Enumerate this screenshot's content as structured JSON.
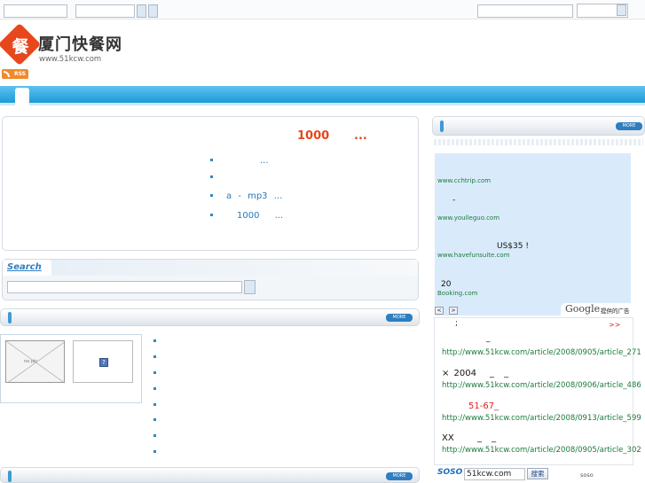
{
  "top": {
    "search_placeholder": ""
  },
  "logo": {
    "glyph": "餐",
    "name": "厦门快餐网",
    "url": "www.51kcw.com",
    "rss": "RSS"
  },
  "headline": {
    "count": "1000",
    "suffix": "...",
    "items": [
      "...",
      "",
      "a - mp3 ...",
      "1000 ..."
    ]
  },
  "search": {
    "title": "Search",
    "value": ""
  },
  "more_label": "MORE",
  "news_panel": {
    "broken_image_text": "no pic",
    "dot_count": 8
  },
  "ads": {
    "links": [
      "www.cchtrip.com",
      "-",
      "www.youlleguo.com",
      "US$35 !",
      "www.havefunsuite.com",
      "20",
      "Booking.com"
    ],
    "google": "Google",
    "google_suffix": "提供的广告",
    "nav_prev": "<",
    "nav_next": ">"
  },
  "side_list": {
    "more": ">>",
    "items": [
      {
        "title": ";",
        "title2": "_",
        "url": "http://www.51kcw.com/article/2008/0905/article_271"
      },
      {
        "title": "× 2004",
        "title2": "_ _",
        "url": "http://www.51kcw.com/article/2008/0906/article_486"
      },
      {
        "title": "51-67_",
        "title2": "",
        "url": "http://www.51kcw.com/article/2008/0913/article_599"
      },
      {
        "title": "XX",
        "title2": "_ _",
        "url": "http://www.51kcw.com/article/2008/0905/article_302"
      }
    ]
  },
  "soso": {
    "logo": "SOSO",
    "value": "51kcw.com",
    "button": "搜索",
    "caption": "soso"
  },
  "colors": {
    "brand_red": "#e8461c",
    "link": "#2878b8",
    "green": "#1d7b3a",
    "bar": "#1e9bd8"
  }
}
